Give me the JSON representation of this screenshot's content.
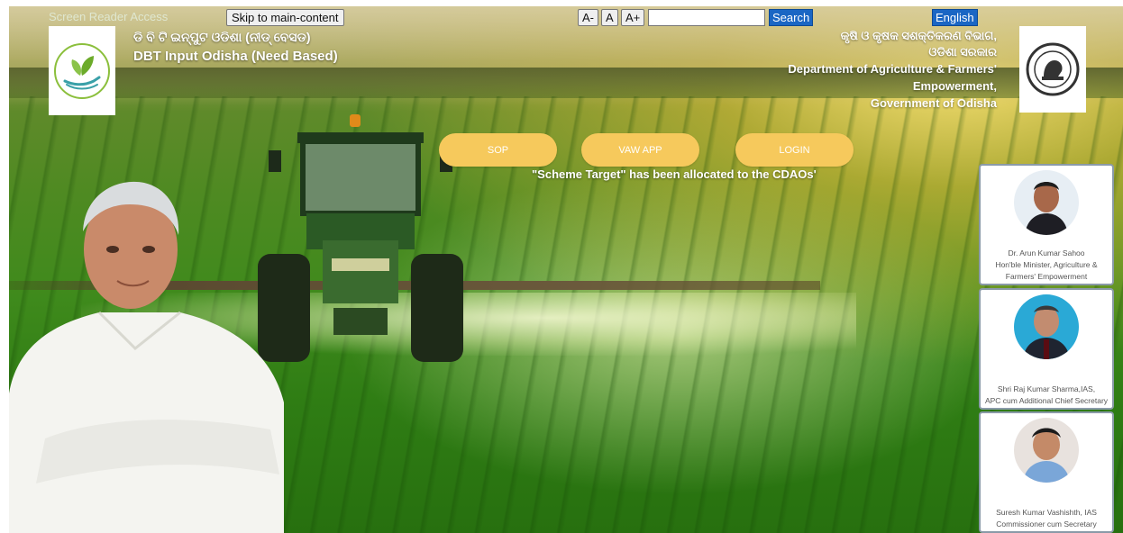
{
  "topbar": {
    "screen_reader": "Screen Reader Access",
    "skip_label": "Skip to main-content",
    "font_decrease": "A-",
    "font_normal": "A",
    "font_increase": "A+",
    "search_value": "",
    "search_label": "Search",
    "language_label": "English"
  },
  "header": {
    "title_odia": "ଡି ବି ଟି ଇନ୍‌ପୁଟ ଓଡିଶା (ନୀଡ୍‌ ବେସଡ)",
    "title_en": "DBT Input Odisha (Need Based)",
    "dept_odia_1": "କୃଷି ଓ କୃଷକ ସଶକ୍ତିକରଣ ବିଭାଗ,",
    "dept_odia_2": "ଓଡିଶା ସରକାର",
    "dept_en_1": "Department of Agriculture & Farmers'",
    "dept_en_2": "Empowerment,",
    "dept_en_3": "Government of Odisha"
  },
  "nav": {
    "sop": "SOP",
    "vaw_app": "VAW APP",
    "login": "LOGIN"
  },
  "notice": "\"Scheme Target\" has been allocated to the CDAOs'",
  "officials": [
    {
      "name": "Dr. Arun Kumar Sahoo",
      "role": "Hon'ble Minister, Agriculture &",
      "role2": "Farmers' Empowerment"
    },
    {
      "name": "Shri Raj Kumar Sharma,IAS,",
      "role": "APC cum Additional Chief Secretary",
      "role2": ""
    },
    {
      "name": "Suresh Kumar Vashishth, IAS",
      "role": "Commissioner cum Secretary",
      "role2": ""
    }
  ],
  "colors": {
    "pill": "#f6c95c",
    "search_btn": "#1a66c4",
    "field_green": "#3f8a1c"
  }
}
